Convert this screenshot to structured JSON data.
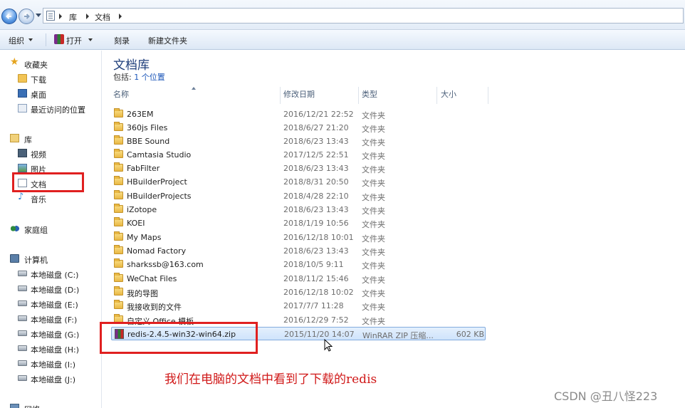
{
  "address_bar": {
    "breadcrumbs": [
      "库",
      "文档"
    ]
  },
  "toolbar": {
    "organize_label": "组织",
    "open_label": "打开",
    "burn_label": "刻录",
    "new_folder_label": "新建文件夹"
  },
  "nav_pane": {
    "favorites": {
      "label": "收藏夹",
      "items": [
        "下载",
        "桌面",
        "最近访问的位置"
      ]
    },
    "libraries": {
      "label": "库",
      "items": [
        "视频",
        "图片",
        "文档",
        "音乐"
      ]
    },
    "homegroup": {
      "label": "家庭组"
    },
    "computer": {
      "label": "计算机",
      "items": [
        "本地磁盘 (C:)",
        "本地磁盘 (D:)",
        "本地磁盘 (E:)",
        "本地磁盘 (F:)",
        "本地磁盘 (G:)",
        "本地磁盘 (H:)",
        "本地磁盘 (I:)",
        "本地磁盘 (J:)"
      ]
    },
    "network": {
      "label": "网络"
    }
  },
  "library": {
    "title": "文档库",
    "includes_prefix": "包括:",
    "includes_link": "1 个位置"
  },
  "columns": {
    "name": "名称",
    "modified": "修改日期",
    "type": "类型",
    "size": "大小"
  },
  "files": [
    {
      "name": "263EM",
      "modified": "2016/12/21 22:52",
      "type": "文件夹",
      "size": "",
      "kind": "folder"
    },
    {
      "name": "360js Files",
      "modified": "2018/6/27 21:20",
      "type": "文件夹",
      "size": "",
      "kind": "folder"
    },
    {
      "name": "BBE Sound",
      "modified": "2018/6/23 13:43",
      "type": "文件夹",
      "size": "",
      "kind": "folder"
    },
    {
      "name": "Camtasia Studio",
      "modified": "2017/12/5 22:51",
      "type": "文件夹",
      "size": "",
      "kind": "folder"
    },
    {
      "name": "FabFilter",
      "modified": "2018/6/23 13:43",
      "type": "文件夹",
      "size": "",
      "kind": "folder"
    },
    {
      "name": "HBuilderProject",
      "modified": "2018/8/31 20:50",
      "type": "文件夹",
      "size": "",
      "kind": "folder"
    },
    {
      "name": "HBuilderProjects",
      "modified": "2018/4/28 22:10",
      "type": "文件夹",
      "size": "",
      "kind": "folder"
    },
    {
      "name": "iZotope",
      "modified": "2018/6/23 13:43",
      "type": "文件夹",
      "size": "",
      "kind": "folder"
    },
    {
      "name": "KOEI",
      "modified": "2018/1/19 10:56",
      "type": "文件夹",
      "size": "",
      "kind": "folder"
    },
    {
      "name": "My Maps",
      "modified": "2016/12/18 10:01",
      "type": "文件夹",
      "size": "",
      "kind": "folder"
    },
    {
      "name": "Nomad Factory",
      "modified": "2018/6/23 13:43",
      "type": "文件夹",
      "size": "",
      "kind": "folder"
    },
    {
      "name": "sharkssb@163.com",
      "modified": "2018/10/5 9:11",
      "type": "文件夹",
      "size": "",
      "kind": "folder"
    },
    {
      "name": "WeChat Files",
      "modified": "2018/11/2 15:46",
      "type": "文件夹",
      "size": "",
      "kind": "folder"
    },
    {
      "name": "我的导图",
      "modified": "2016/12/18 10:02",
      "type": "文件夹",
      "size": "",
      "kind": "folder"
    },
    {
      "name": "我接收到的文件",
      "modified": "2017/7/7 11:28",
      "type": "文件夹",
      "size": "",
      "kind": "folder"
    },
    {
      "name": "自定义 Office 模板",
      "modified": "2016/12/29 7:52",
      "type": "文件夹",
      "size": "",
      "kind": "folder"
    },
    {
      "name": "redis-2.4.5-win32-win64.zip",
      "modified": "2015/11/20 14:07",
      "type": "WinRAR ZIP 压缩...",
      "size": "602 KB",
      "kind": "zip"
    }
  ],
  "caption": "我们在电脑的文档中看到了下载的redis",
  "watermark": "CSDN @丑八怪223",
  "colors": {
    "highlight_red": "#e02020",
    "caption_red": "#d01818",
    "title_blue": "#1d3d7a"
  }
}
